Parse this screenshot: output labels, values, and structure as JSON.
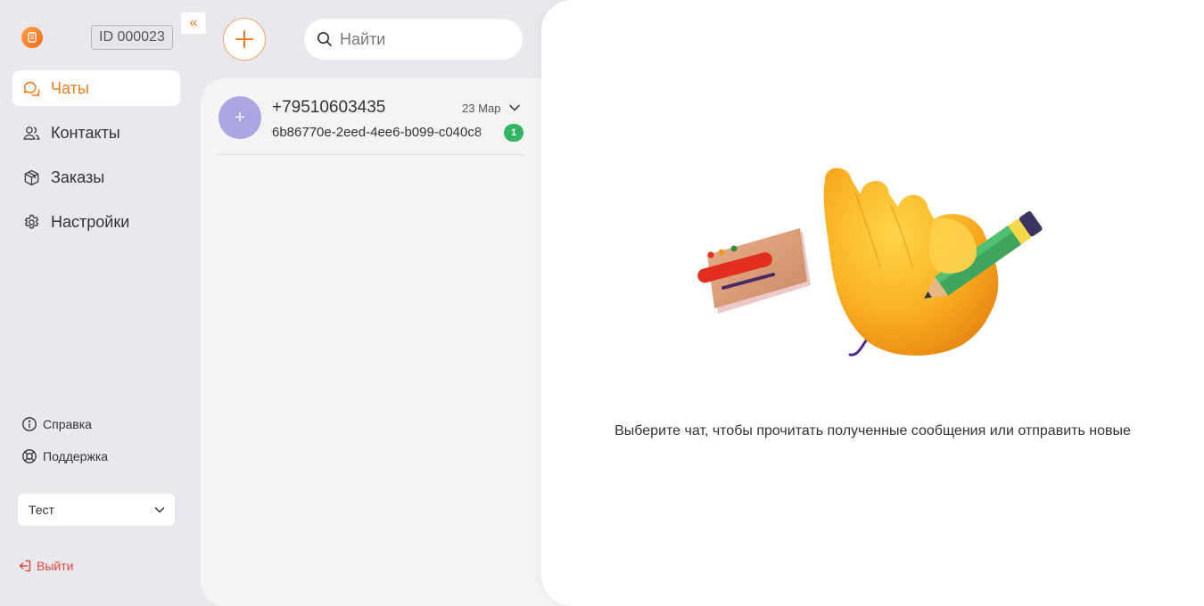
{
  "app": {
    "account_id": "ID 000023",
    "collapse_icon": "«",
    "brand_color": "#f07a1e"
  },
  "nav": {
    "items": [
      {
        "label": "Чаты",
        "icon": "chat-icon",
        "active": true
      },
      {
        "label": "Контакты",
        "icon": "contacts-icon",
        "active": false
      },
      {
        "label": "Заказы",
        "icon": "box-icon",
        "active": false
      },
      {
        "label": "Настройки",
        "icon": "gear-icon",
        "active": false
      }
    ]
  },
  "aux": {
    "help_label": "Справка",
    "support_label": "Поддержка"
  },
  "company": {
    "selected": "Тест"
  },
  "logout": {
    "label": "Выйти"
  },
  "search": {
    "placeholder": "Найти"
  },
  "chats": [
    {
      "avatar_symbol": "+",
      "name": "+79510603435",
      "date": "23 Мар",
      "preview": "6b86770e-2eed-4ee6-b099-c040c8",
      "unread": "1"
    }
  ],
  "main": {
    "empty_message": "Выберите чат, чтобы прочитать полученные сообщения или отправить новые"
  }
}
